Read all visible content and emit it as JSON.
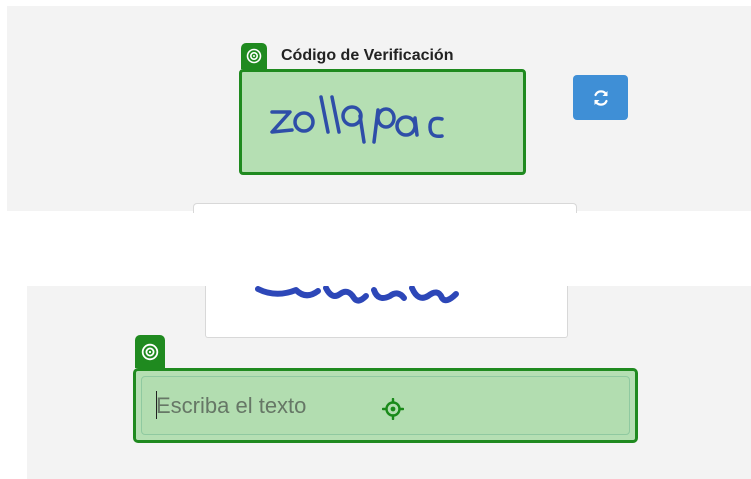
{
  "captcha_section": {
    "label": "Código de Verificación",
    "captcha_text": "zollqpac",
    "refresh_icon": "refresh-icon",
    "tag_icon": "target-ring-icon"
  },
  "captcha_bottom": {
    "partial_text": "ennuuo"
  },
  "text_input": {
    "placeholder": "Escriba el texto",
    "value": "",
    "locator_icon": "crosshair-icon"
  },
  "colors": {
    "highlight_fill": "#b5dfb3",
    "highlight_border": "#1f8a1f",
    "refresh_button": "#3f8fd6",
    "panel_bg": "#f3f3f3"
  }
}
